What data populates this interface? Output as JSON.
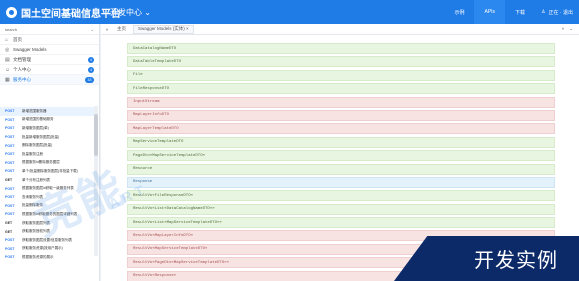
{
  "header": {
    "title": "国土空间基础信息平台",
    "app_switch": "开发中心 ⌄",
    "tabs": [
      "示例",
      "APIs",
      "下载"
    ],
    "user": "正在 · 退出"
  },
  "sidebar": {
    "search_placeholder": "search",
    "items": [
      {
        "label": "首页",
        "icon": "home-icon"
      },
      {
        "label": "Swagger Models",
        "icon": "swagger-icon"
      },
      {
        "label": "文档管理",
        "icon": "document-icon",
        "badge": "4"
      },
      {
        "label": "个人中心",
        "icon": "user-icon",
        "badge": "4"
      },
      {
        "label": "服务中心",
        "icon": "service-icon",
        "badge": "33"
      }
    ],
    "apis": [
      {
        "method": "POST",
        "label": "新增范围服务器"
      },
      {
        "method": "POST",
        "label": "新增范围的基础服务"
      },
      {
        "method": "POST",
        "label": "新增服务图层(单)"
      },
      {
        "method": "POST",
        "label": "批量新增服务图层(批量)"
      },
      {
        "method": "POST",
        "label": "删除服务图层(批量)"
      },
      {
        "method": "POST",
        "label": "批量服务注册"
      },
      {
        "method": "POST",
        "label": "根据服务id删除服务图层"
      },
      {
        "method": "POST",
        "label": "单个/批量删除服务图层(非批量下载)"
      },
      {
        "method": "GET",
        "label": "单个分布注册列表"
      },
      {
        "method": "POST",
        "label": "根据服务图层id获取一级服务列表"
      },
      {
        "method": "POST",
        "label": "查询服务列表"
      },
      {
        "method": "POST",
        "label": "批量删除服务"
      },
      {
        "method": "POST",
        "label": "根据服务id获取服务的图层详细列表"
      },
      {
        "method": "GET",
        "label": "获取服务图层列表"
      },
      {
        "method": "GET",
        "label": "获取服务授权列表"
      },
      {
        "method": "POST",
        "label": "获取服务图层设置/信息服务列表"
      },
      {
        "method": "POST",
        "label": "获取服务资源(按用户展示)"
      },
      {
        "method": "POST",
        "label": "根据服务资源的展示"
      }
    ]
  },
  "main": {
    "tabs": [
      {
        "label": "主页"
      },
      {
        "label": "Swagger Models (实体) ×"
      }
    ],
    "models": [
      "DataCatalogNameDTO",
      "DataTableTemplateDTO",
      "File",
      "FileResponseDTO",
      "InputStream",
      "MapLayerInfoDTO",
      "MapLayerTemplateDTO",
      "MapServiceTemplateDTO",
      "PageDto«MapServiceTemplateDTO»",
      "Resource",
      "Response",
      "ResultVo«FileResponseDTO»",
      "ResultVo«List«DataCatalogNameDTO»»",
      "ResultVo«List«MapServiceTemplateDTO»»",
      "ResultVo«MapLayerInfoDTO»",
      "ResultVo«MapServiceTemplateDTO»",
      "ResultVo«PageDto«MapServiceTemplateDTO»»",
      "ResultVo«Response»"
    ],
    "model_colors": [
      "green",
      "green",
      "green",
      "green",
      "red",
      "red",
      "red",
      "green",
      "green",
      "green",
      "blue",
      "green",
      "green",
      "green",
      "red",
      "red",
      "red",
      "red"
    ]
  },
  "overlay": {
    "watermark": "竞能",
    "watermark_sub": "ART",
    "banner": "开发实例"
  },
  "colors": {
    "brand": "#1f7be6",
    "banner": "#0d2a68",
    "post_method": "#2f7cf6"
  }
}
